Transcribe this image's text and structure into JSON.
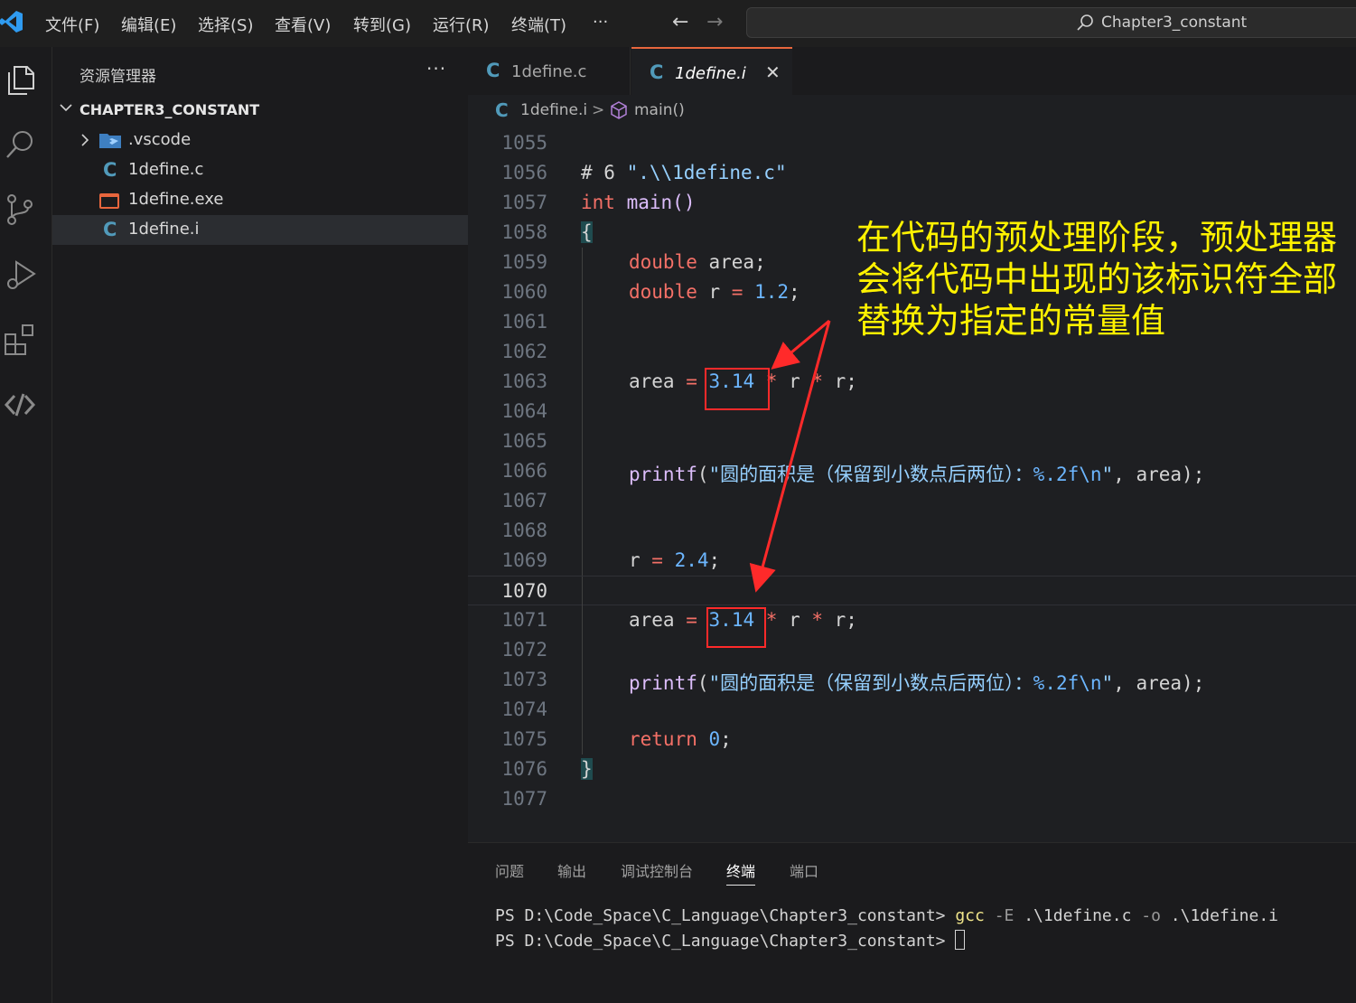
{
  "titlebar": {
    "menu": [
      "文件(F)",
      "编辑(E)",
      "选择(S)",
      "查看(V)",
      "转到(G)",
      "运行(R)",
      "终端(T)",
      "···"
    ],
    "search_text": "Chapter3_constant"
  },
  "sidebar": {
    "title": "资源管理器",
    "more": "···",
    "folder": "CHAPTER3_CONSTANT",
    "items": [
      {
        "label": ".vscode",
        "icon": "vscode-folder-icon"
      },
      {
        "label": "1define.c",
        "icon": "c-file-icon"
      },
      {
        "label": "1define.exe",
        "icon": "exe-file-icon"
      },
      {
        "label": "1define.i",
        "icon": "c-file-icon"
      }
    ]
  },
  "tabs": [
    {
      "label": "1define.c"
    },
    {
      "label": "1define.i",
      "active": true
    }
  ],
  "breadcrumb": {
    "file": "1define.i",
    "func": "main()"
  },
  "code": {
    "lines": [
      {
        "n": "1055"
      },
      {
        "n": "1056",
        "a": "# 6 ",
        "b": "\".\\\\1define.c\""
      },
      {
        "n": "1057",
        "a": "int",
        "b": " ",
        "c": "main",
        "d": "()"
      },
      {
        "n": "1058",
        "brace": "{"
      },
      {
        "n": "1059",
        "a": "double",
        "b": " area;"
      },
      {
        "n": "1060",
        "a": "double",
        "b": " r ",
        "c": "=",
        "d": " ",
        "e": "1.2",
        "f": ";"
      },
      {
        "n": "1061"
      },
      {
        "n": "1062"
      },
      {
        "n": "1063",
        "a": "area ",
        "b": "=",
        "c": " ",
        "d": "3.14",
        "e": " ",
        "f": "*",
        "g": " r ",
        "h": "*",
        "i": " r;"
      },
      {
        "n": "1064"
      },
      {
        "n": "1065"
      },
      {
        "n": "1066",
        "a": "printf",
        "b": "(",
        "c": "\"圆的面积是（保留到小数点后两位）：",
        "d": "%.2f\\n",
        "e": "\"",
        "f": ", area);"
      },
      {
        "n": "1067"
      },
      {
        "n": "1068"
      },
      {
        "n": "1069",
        "a": "r ",
        "b": "=",
        "c": " ",
        "d": "2.4",
        "e": ";"
      },
      {
        "n": "1070"
      },
      {
        "n": "1071",
        "a": "area ",
        "b": "=",
        "c": " ",
        "d": "3.14",
        "e": " ",
        "f": "*",
        "g": " r ",
        "h": "*",
        "i": " r;"
      },
      {
        "n": "1072"
      },
      {
        "n": "1073",
        "a": "printf",
        "b": "(",
        "c": "\"圆的面积是（保留到小数点后两位）：",
        "d": "%.2f\\n",
        "e": "\"",
        "f": ", area);"
      },
      {
        "n": "1074"
      },
      {
        "n": "1075",
        "a": "return",
        "b": " ",
        "c": "0",
        "d": ";"
      },
      {
        "n": "1076",
        "brace": "}"
      },
      {
        "n": "1077"
      }
    ]
  },
  "annotation": {
    "text": "在代码的预处理阶段，预处理器会将代码中出现的该标识符全部替换为指定的常量值",
    "color": "#fff200",
    "box_color": "#ff2a2a"
  },
  "panel": {
    "tabs": [
      "问题",
      "输出",
      "调试控制台",
      "终端",
      "端口"
    ],
    "active_tab": "终端",
    "terminal": {
      "prompt": "PS D:\\Code_Space\\C_Language\\Chapter3_constant> ",
      "cmd": "gcc",
      "flag1": " -E ",
      "arg1": ".\\1define.c",
      "flag2": " -o ",
      "arg2": ".\\1define.i"
    }
  }
}
